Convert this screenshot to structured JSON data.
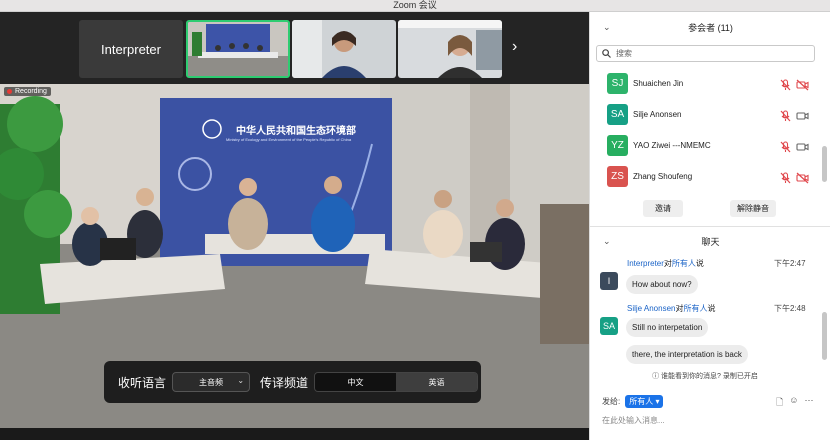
{
  "window": {
    "title": "Zoom 会议"
  },
  "gallery": {
    "label_tile": "Interpreter",
    "next_glyph": "›"
  },
  "meeting": {
    "recording_label": "Recording",
    "backdrop_title_cn": "中华人民共和国生态环境部",
    "backdrop_title_en": "Ministry of Ecology and Environment of the People's Republic of China"
  },
  "interpretation": {
    "listen_label": "收听语言",
    "listen_value": "主音频",
    "channel_label": "传译频道",
    "channels": [
      "中文",
      "英语"
    ],
    "selected_channel": "英语"
  },
  "participants": {
    "title": "参会者 (11)",
    "search_placeholder": "搜索",
    "list": [
      {
        "initials": "SJ",
        "name": "Shuaichen Jin",
        "color": "#2db36b",
        "mic_muted": true,
        "video_off": true
      },
      {
        "initials": "SA",
        "name": "Silje Anonsen",
        "color": "#16a085",
        "mic_muted": true,
        "video_off": false
      },
      {
        "initials": "YZ",
        "name": "YAO Ziwei ---NMEMC",
        "color": "#27ae60",
        "mic_muted": true,
        "video_off": false
      },
      {
        "initials": "ZS",
        "name": "Zhang Shoufeng",
        "color": "#d9534f",
        "mic_muted": true,
        "video_off": true
      }
    ],
    "invite_label": "邀请",
    "unmute_label": "解除静音"
  },
  "chat": {
    "title": "聊天",
    "messages": [
      {
        "sender": "Interpreter",
        "to_text": "对",
        "audience": "所有人",
        "suffix": "说",
        "time": "下午2:47",
        "avatar": "I",
        "avatar_color": "#3b4a5c",
        "lines": [
          "How about now?"
        ]
      },
      {
        "sender": "Silje Anonsen",
        "to_text": "对",
        "audience": "所有人",
        "suffix": "说",
        "time": "下午2:48",
        "avatar": "SA",
        "avatar_color": "#16a085",
        "lines": [
          "Still no interpetation",
          "there, the interpretation is back"
        ]
      }
    ],
    "notice": "谁能看到你的消息? 录制已开启",
    "send_to_label": "发给:",
    "send_to_value": "所有人",
    "composer_placeholder": "在此处输入消息..."
  },
  "colors": {
    "accent": "#1b73e8",
    "active_tile": "#2ecc71",
    "recording": "#e53935"
  }
}
